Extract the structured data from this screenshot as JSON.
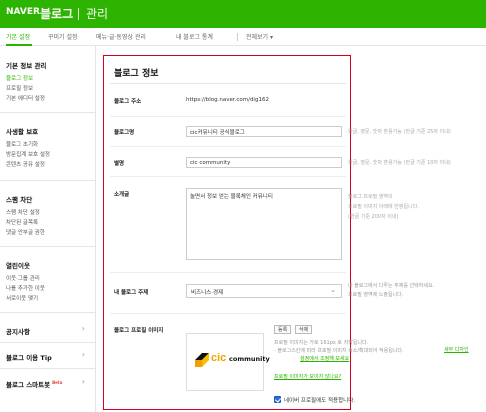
{
  "header": {
    "brand": "NAVER",
    "service": "블로그",
    "title": "관리"
  },
  "tabs": [
    {
      "label": "기본 설정",
      "active": true
    },
    {
      "label": "꾸미기 설정",
      "active": false
    },
    {
      "label": "메뉴·글·동영상 관리",
      "active": false
    },
    {
      "label": "내 블로그 통계",
      "active": false
    },
    {
      "label": "전체보기 ▾",
      "active": false
    }
  ],
  "sidebar": {
    "sections": [
      {
        "title": "기본 정보 관리",
        "items": [
          {
            "label": "블로그 정보",
            "active": true
          },
          {
            "label": "프로필 정보",
            "active": false
          },
          {
            "label": "기본 에디터 설정",
            "active": false
          }
        ]
      },
      {
        "title": "사생활 보호",
        "items": [
          {
            "label": "블로그 초기화",
            "active": false
          },
          {
            "label": "방문집계 보호 설정",
            "active": false
          },
          {
            "label": "콘텐츠 공유 설정",
            "active": false
          }
        ]
      },
      {
        "title": "스팸 차단",
        "items": [
          {
            "label": "스팸 차단 설정",
            "active": false
          },
          {
            "label": "차단된 글목록",
            "active": false
          },
          {
            "label": "댓글 안부글 권한",
            "active": false
          }
        ]
      },
      {
        "title": "열린이웃",
        "items": [
          {
            "label": "이웃·그룹 관리",
            "active": false
          },
          {
            "label": "나를 추가한 이웃",
            "active": false
          },
          {
            "label": "서로이웃 맺기",
            "active": false
          }
        ]
      }
    ],
    "links": [
      {
        "label": "공지사항"
      },
      {
        "label": "블로그 이용 Tip"
      },
      {
        "label": "블로그 스마트봇",
        "badge": "Beta"
      }
    ]
  },
  "main": {
    "title": "블로그 정보",
    "address_label": "블로그 주소",
    "address_value": "https://blog.naver.com/dig162",
    "name_label": "블로그명",
    "name_value": "cic커뮤니티 공식블로그",
    "name_help": "한글, 영문, 숫자 혼용가능 (한글 기준 25자 이내)",
    "alias_label": "별명",
    "alias_value": "cic community",
    "alias_help": "한글, 영문, 숫자 혼용가능 (한글 기준 10자 이내)",
    "intro_label": "소개글",
    "intro_value": "놀면서 정보 얻는 블록체인 커뮤니티",
    "intro_help": [
      "블로그 프로필 영역의",
      "프로필 이미지 아래에 반영됩니다.",
      "(한글 기준 200자 이내)"
    ],
    "topic_label": "내 블로그 주제",
    "topic_value": "비즈니스·경제",
    "topic_help": [
      "내 블로그에서 다루는 주제를 선택하세요.",
      "프로필 영역에 노출됩니다."
    ],
    "image_label": "블로그 프로필 이미지",
    "register_btn": "등록",
    "delete_btn": "삭제",
    "image_help": [
      "프로필 이미지는 가로 161px 로 저장됩니다.",
      "- 블로그스킨에 따라 프로필 이미지 축소/확대되어 적용됩니다."
    ],
    "image_link1": "세부 디자인",
    "image_link2": "설정에서 조정해 보세요",
    "profile_link": "프로필 이미지가 보이지 않나요?",
    "checkbox_label": "네이버 프로필에도 적용합니다.",
    "checkbox_checked": true,
    "logo_prefix": "cic",
    "logo_word": "community"
  }
}
